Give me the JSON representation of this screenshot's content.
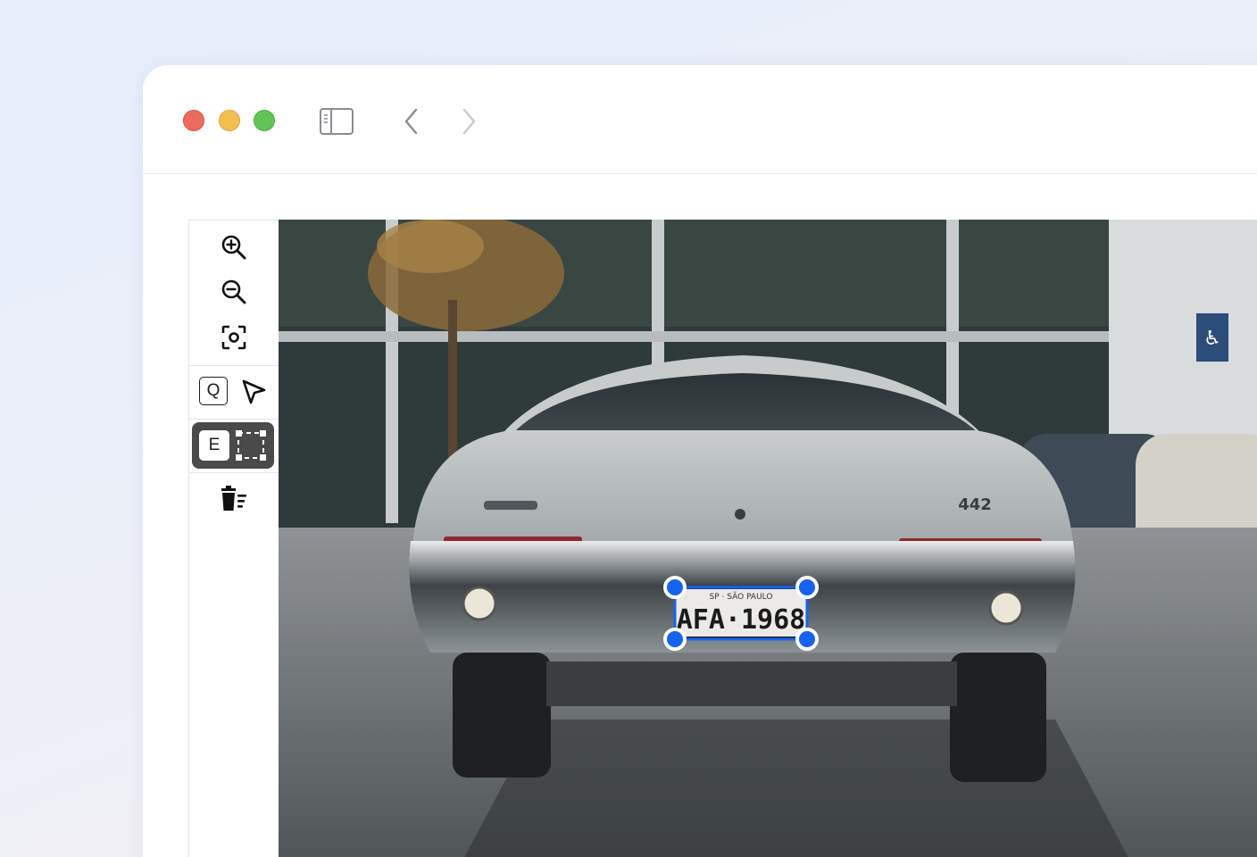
{
  "window": {
    "traffic_lights": [
      "close",
      "minimize",
      "maximize"
    ],
    "colors": {
      "close": "#ec6a5e",
      "minimize": "#f4bf4f",
      "maximize": "#61c554"
    }
  },
  "toolbar": {
    "zoom_in_icon": "zoom-in-icon",
    "zoom_out_icon": "zoom-out-icon",
    "focus_icon": "focus-icon",
    "select_shortcut": "Q",
    "select_icon": "cursor-arrow-icon",
    "rectangle_shortcut": "E",
    "rectangle_icon": "bounding-box-icon",
    "delete_icon": "delete-all-icon"
  },
  "image": {
    "car_badge": "442",
    "plate_region": "SP · SÃO PAULO",
    "plate_number": "AFA·1968"
  },
  "annotation": {
    "color": "#1463f3",
    "handles": 4
  }
}
